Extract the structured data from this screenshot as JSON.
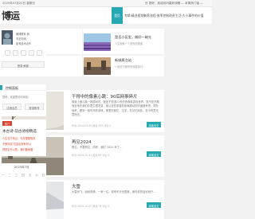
{
  "topbar": {
    "date": "2025年07月20日 星期日",
    "notice": "日 您好，欢迎访问高效流程 — 本周热门话 —"
  },
  "logo": {
    "text": "博运"
  },
  "nav": [
    {
      "label": "首页",
      "active": true
    },
    {
      "label": "专辑·精选视频集锦",
      "active": false
    },
    {
      "label": "流程·效率控制改进",
      "active": false
    },
    {
      "label": "生活·大小事件的价值",
      "active": false
    },
    {
      "label": "学习·成长若干等辑",
      "active": false
    },
    {
      "label": "联系",
      "active": false
    }
  ],
  "featured": [
    {
      "title": "为什么会存在千博客网站",
      "snippet": "一日之计在于晨，在于知识"
    },
    {
      "title": "是否小区里，做好一碗光",
      "snippet": "人生就像一个漫长的旅途"
    },
    {
      "title": "四分之一的工作和生活",
      "snippet": "这篇文章是为了让大家明白"
    },
    {
      "title": "新城周点站",
      "snippet": "一场关于城市的深度探讨"
    }
  ],
  "posts": [
    {
      "title": "干得中的像素心跳：90后网事碎片",
      "excerpt": "像素上面心跳一种游戏时，我还不知道21世纪的像素游戏世界，是不是不期而至地在我们心里生根发芽，就让这些零星的像素跳动的情绪回来吧，现在就来，看到一段时光的游戏，那里的回忆、文字，在记忆深处，至今有意无意而去。",
      "meta": "年份·2024-03-05  阅读 109  评论 0",
      "more": "阅读全文"
    },
    {
      "title": "再见2024",
      "excerpt": "再见，不要再见，同样，我们 2024 年了…",
      "meta": "年份·2024-12-31  阅读 88  评论 0",
      "more": "阅读全文"
    },
    {
      "title": "大雪",
      "excerpt": "大雪纷飞，纷纷扬扬，一来一往，原来冬天也很美，而你说的话也就只…",
      "meta": "年份·2024-12-07  阅读 76  评论 0",
      "more": "阅读全文"
    }
  ],
  "sidebar": {
    "contact_links": [
      "微博联系·我",
      "不定时间",
      "如有技术合作"
    ],
    "login_text": "登录·刷新",
    "control_panel_title": "控制面板",
    "control_panel_greeting": "您好，欢迎您访问本站！",
    "control_buttons": [
      "注册会员",
      "登录帐号"
    ],
    "hot_badge": "热门",
    "hot_title": "本古诗·前古诗榜精选",
    "hot_lines": [
      "人生在于有点，与好搭配相关",
      "不断测试·沉淀出来有份公",
      "把是否可以的，我们做就做"
    ],
    "calendar_title": "2025年7月",
    "calendar_weekdays": [
      "一",
      "二",
      "三",
      "四",
      "五",
      "六",
      "日"
    ]
  },
  "colors": {
    "accent": "#27a9b4",
    "hot": "#d9452e"
  }
}
